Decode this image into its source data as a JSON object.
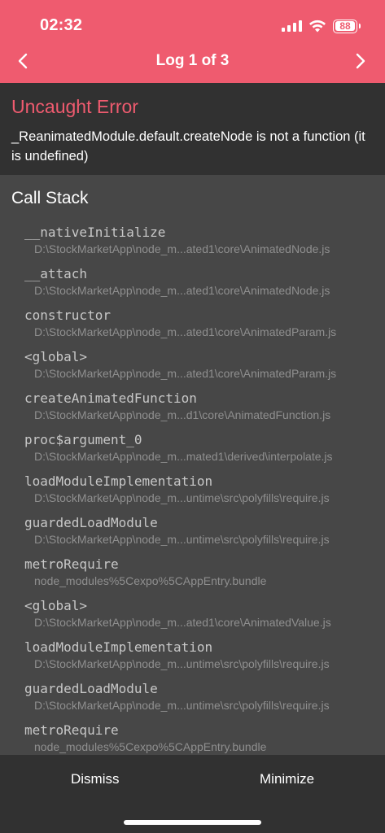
{
  "status_bar": {
    "time": "02:32",
    "battery_level": "88",
    "icons": [
      "signal-icon",
      "wifi-icon",
      "battery-icon"
    ]
  },
  "header": {
    "title": "Log 1 of 3",
    "prev_icon": "chevron-left-icon",
    "next_icon": "chevron-right-icon",
    "background_color": "#ef5b6f"
  },
  "error": {
    "title": "Uncaught Error",
    "message": "_ReanimatedModule.default.createNode is not a function (it is undefined)",
    "title_color": "#ef5b6f"
  },
  "call_stack": {
    "title": "Call Stack",
    "frames": [
      {
        "method": "__nativeInitialize",
        "file": "D:\\StockMarketApp\\node_m...ated1\\core\\AnimatedNode.js"
      },
      {
        "method": "__attach",
        "file": "D:\\StockMarketApp\\node_m...ated1\\core\\AnimatedNode.js"
      },
      {
        "method": "constructor",
        "file": "D:\\StockMarketApp\\node_m...ated1\\core\\AnimatedParam.js"
      },
      {
        "method": "<global>",
        "file": "D:\\StockMarketApp\\node_m...ated1\\core\\AnimatedParam.js"
      },
      {
        "method": "createAnimatedFunction",
        "file": "D:\\StockMarketApp\\node_m...d1\\core\\AnimatedFunction.js"
      },
      {
        "method": "proc$argument_0",
        "file": "D:\\StockMarketApp\\node_m...mated1\\derived\\interpolate.js"
      },
      {
        "method": "loadModuleImplementation",
        "file": "D:\\StockMarketApp\\node_m...untime\\src\\polyfills\\require.js"
      },
      {
        "method": "guardedLoadModule",
        "file": "D:\\StockMarketApp\\node_m...untime\\src\\polyfills\\require.js"
      },
      {
        "method": "metroRequire",
        "file": "node_modules%5Cexpo%5CAppEntry.bundle"
      },
      {
        "method": "<global>",
        "file": "D:\\StockMarketApp\\node_m...ated1\\core\\AnimatedValue.js"
      },
      {
        "method": "loadModuleImplementation",
        "file": "D:\\StockMarketApp\\node_m...untime\\src\\polyfills\\require.js"
      },
      {
        "method": "guardedLoadModule",
        "file": "D:\\StockMarketApp\\node_m...untime\\src\\polyfills\\require.js"
      },
      {
        "method": "metroRequire",
        "file": "node_modules%5Cexpo%5CAppEntry.bundle"
      }
    ]
  },
  "footer": {
    "dismiss_label": "Dismiss",
    "minimize_label": "Minimize"
  }
}
